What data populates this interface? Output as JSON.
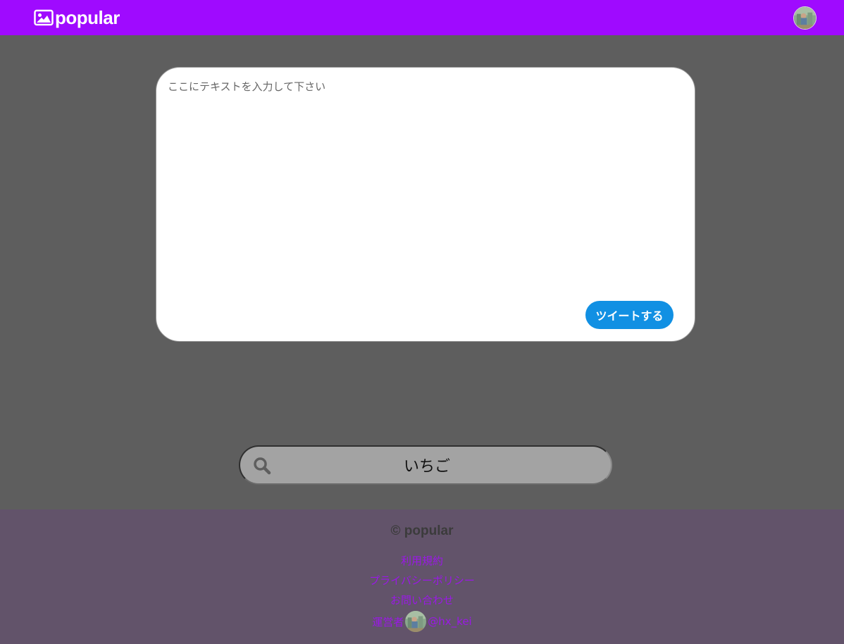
{
  "header": {
    "logo_text": "popular",
    "logo_icon": "image-icon",
    "avatar_icon": "user-avatar"
  },
  "compose": {
    "placeholder": "ここにテキストを入力して下さい",
    "submit_label": "ツイートする"
  },
  "search": {
    "icon": "search-icon",
    "value": "いちご"
  },
  "footer": {
    "copyright": "© popular",
    "links": [
      {
        "label": "利用規約"
      },
      {
        "label": "プライバシーポリシー"
      },
      {
        "label": "お問い合わせ"
      }
    ],
    "operator_label": "運営者",
    "operator_handle": "@hx_kei"
  },
  "colors": {
    "brand": "#9f0aff",
    "background": "#5e5e5e",
    "tweet_button": "#1190e3",
    "footer_bg": "#62536a",
    "footer_link": "#9a18e6"
  }
}
